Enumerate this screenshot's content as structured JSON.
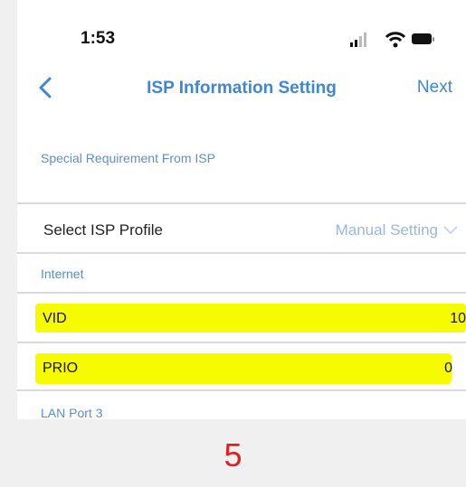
{
  "status_bar": {
    "time": "1:53"
  },
  "navbar": {
    "title": "ISP Information Setting",
    "next_label": "Next"
  },
  "section_special": "Special Requirement From ISP",
  "isp_profile": {
    "label": "Select ISP Profile",
    "value": "Manual Setting"
  },
  "section_internet": "Internet",
  "vid": {
    "label": "VID",
    "value": "10"
  },
  "prio": {
    "label": "PRIO",
    "value": "0"
  },
  "section_lan": "LAN Port 3",
  "page_number": "5",
  "colors": {
    "accent": "#3d86d8",
    "highlight": "#f7fb00",
    "page_number": "#e02020"
  }
}
